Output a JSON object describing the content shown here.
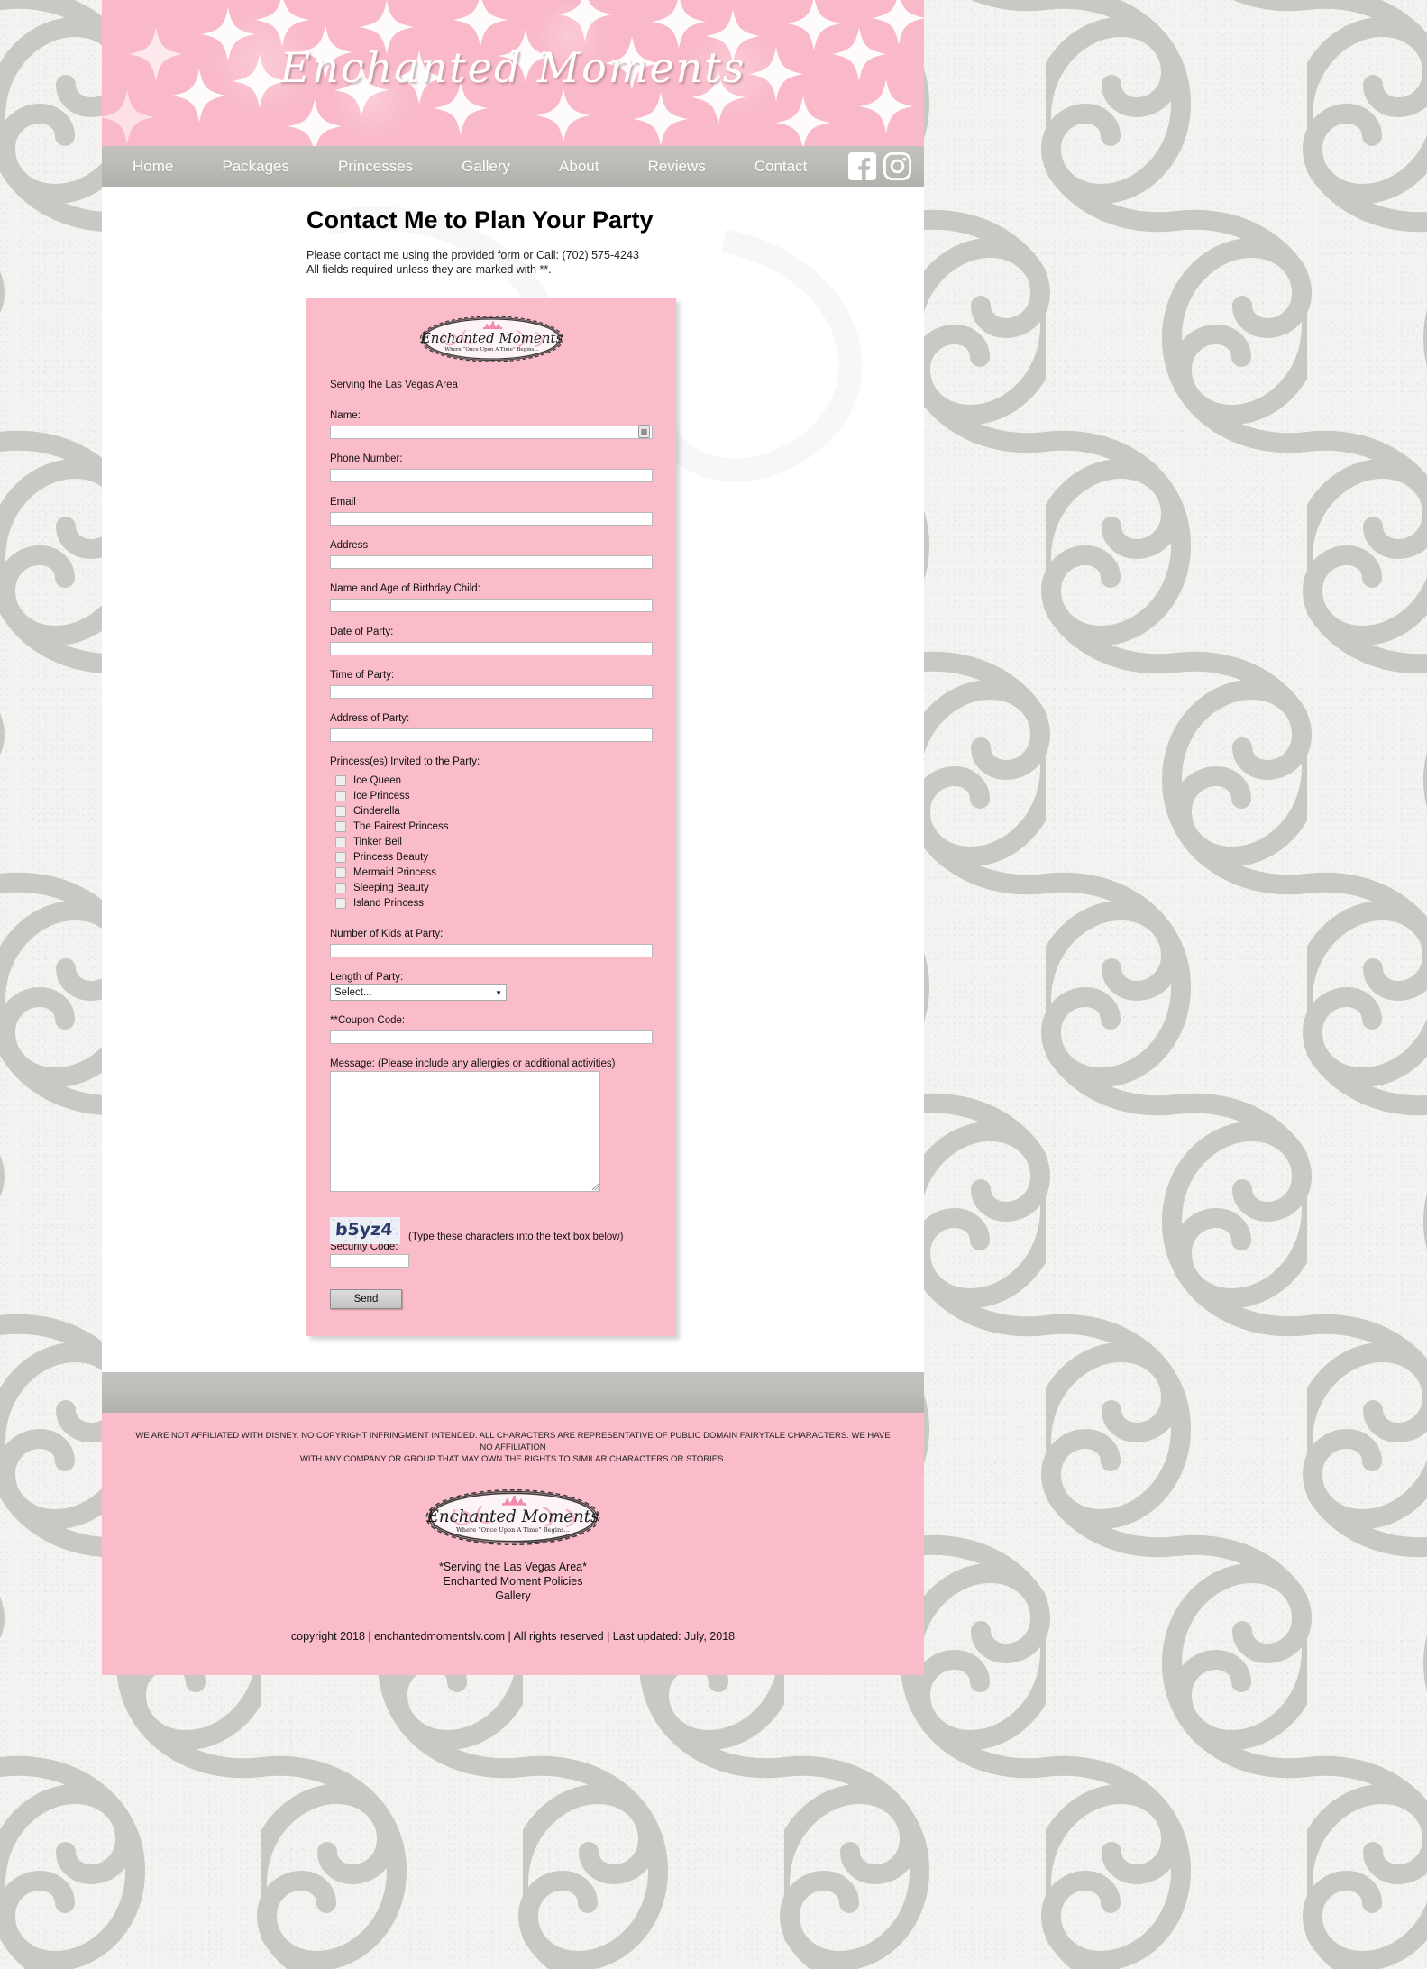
{
  "site": {
    "banner_title": "Enchanted Moments",
    "logo_name": "Enchanted Moments",
    "logo_tagline": "Where “Once Upon A Time” Begins...",
    "accent_pink": "#f9bcc8",
    "nav_gray": "#bdbbb7"
  },
  "nav": {
    "items": [
      {
        "label": "Home",
        "name": "nav-home"
      },
      {
        "label": "Packages",
        "name": "nav-packages"
      },
      {
        "label": "Princesses",
        "name": "nav-princesses"
      },
      {
        "label": "Gallery",
        "name": "nav-gallery"
      },
      {
        "label": "About",
        "name": "nav-about"
      },
      {
        "label": "Reviews",
        "name": "nav-reviews"
      },
      {
        "label": "Contact",
        "name": "nav-contact"
      }
    ],
    "social": [
      {
        "icon": "facebook-icon"
      },
      {
        "icon": "instagram-icon"
      }
    ]
  },
  "main": {
    "title": "Contact Me to Plan Your Party",
    "intro_line1": "Please contact me using the provided form or Call: (702) 575-4243",
    "intro_line2": "All fields required unless they are marked with **."
  },
  "form": {
    "serving_note": "Serving the Las Vegas Area",
    "fields": [
      {
        "label": "Name:",
        "value": "",
        "name": "name-input"
      },
      {
        "label": "Phone Number:",
        "value": "",
        "name": "phone-input"
      },
      {
        "label": "Email",
        "value": "",
        "name": "email-input"
      },
      {
        "label": "Address",
        "value": "",
        "name": "address-input"
      },
      {
        "label": "Name and Age of Birthday Child:",
        "value": "",
        "name": "birthday-child-input"
      },
      {
        "label": "Date of Party:",
        "value": "",
        "name": "date-of-party-input"
      },
      {
        "label": "Time of Party:",
        "value": "",
        "name": "time-of-party-input"
      },
      {
        "label": "Address of Party:",
        "value": "",
        "name": "address-of-party-input"
      }
    ],
    "princess_label": "Princess(es) Invited to the Party:",
    "princesses": [
      "Ice Queen",
      "Ice Princess",
      "Cinderella",
      "The Fairest Princess",
      "Tinker Bell",
      "Princess Beauty",
      "Mermaid Princess",
      "Sleeping Beauty",
      "Island Princess"
    ],
    "kids_label": "Number of Kids at Party:",
    "kids_value": "",
    "length_label": "Length of Party:",
    "length_selected": "Select...",
    "coupon_label": "**Coupon Code:",
    "coupon_value": "",
    "message_label": "Message: (Please include any allergies or additional activities)",
    "message_value": "",
    "captcha_text": "b5yz4",
    "captcha_hint": "(Type these characters into the text box below)",
    "security_label": "Security Code:",
    "security_value": "",
    "send_label": "Send"
  },
  "footer": {
    "disclaimer_line1": "WE ARE NOT AFFILIATED WITH DISNEY. NO COPYRIGHT INFRINGMENT INTENDED. ALL CHARACTERS ARE REPRESENTATIVE OF PUBLIC DOMAIN FAIRYTALE CHARACTERS. WE HAVE NO AFFILIATION",
    "disclaimer_line2": "WITH ANY COMPANY OR GROUP THAT MAY OWN THE RIGHTS TO SIMILAR CHARACTERS OR STORIES.",
    "links": [
      "*Serving the Las Vegas Area*",
      "Enchanted Moment Policies",
      "Gallery"
    ],
    "copyright": "copyright 2018 | enchantedmomentslv.com | All rights reserved | Last updated: July, 2018"
  }
}
